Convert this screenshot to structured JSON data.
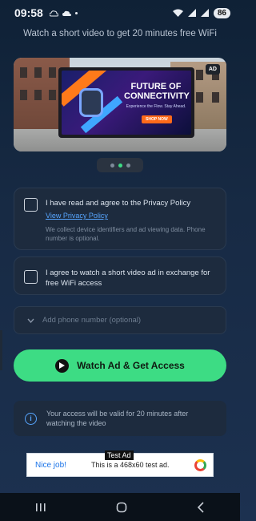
{
  "status_bar": {
    "time": "09:58",
    "battery": "86",
    "left_icons": [
      "cloud-icon",
      "cloud-filled-icon",
      "dot-icon"
    ],
    "right_icons": [
      "wifi-icon",
      "signal-icon",
      "signal-icon-2"
    ]
  },
  "header": {
    "headline": "Watch a short video to get 20 minutes free WiFi"
  },
  "ad_preview": {
    "badge": "AD",
    "billboard_title": "FUTURE OF CONNECTIVITY",
    "billboard_subtitle": "Experience the Flow. Stay Ahead.",
    "billboard_cta": "SHOP NOW",
    "carousel_dots": 3,
    "active_dot": 1
  },
  "consent": {
    "privacy_label": "I have read and agree to the Privacy Policy",
    "privacy_link": "View Privacy Policy",
    "privacy_note": "We collect device identifiers and ad viewing data. Phone number is optional.",
    "ad_label": "I agree to watch a short video ad in exchange for free WiFi access"
  },
  "phone": {
    "placeholder": "Add phone number (optional)"
  },
  "cta": {
    "label": "Watch Ad & Get Access"
  },
  "info": {
    "text": "Your access will be valid for 20 minutes after watching the video"
  },
  "test_banner": {
    "label": "Test Ad",
    "nice": "Nice job!",
    "message": "This is a 468x60 test ad."
  },
  "colors": {
    "accent": "#3ddc84",
    "link": "#57a6ff",
    "background": "#172a44"
  }
}
